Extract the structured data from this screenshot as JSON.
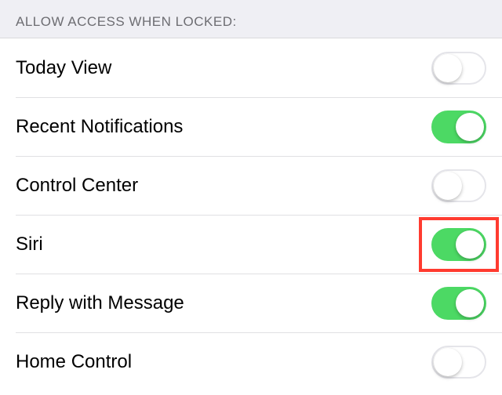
{
  "section": {
    "header": "ALLOW ACCESS WHEN LOCKED:"
  },
  "rows": [
    {
      "label": "Today View",
      "on": false
    },
    {
      "label": "Recent Notifications",
      "on": true
    },
    {
      "label": "Control Center",
      "on": false
    },
    {
      "label": "Siri",
      "on": true,
      "highlighted": true
    },
    {
      "label": "Reply with Message",
      "on": true
    },
    {
      "label": "Home Control",
      "on": false
    }
  ],
  "colors": {
    "switch_on": "#4cd964",
    "highlight": "#ff3b30"
  }
}
